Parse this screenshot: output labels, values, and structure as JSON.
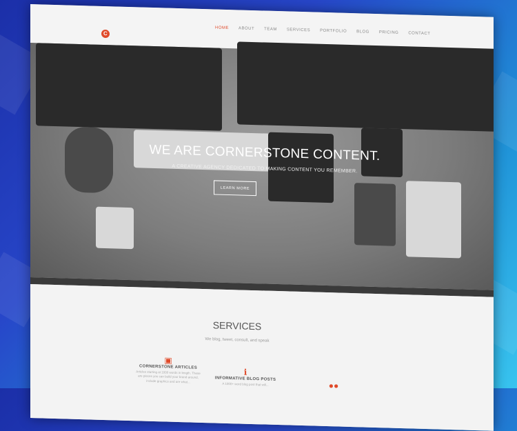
{
  "nav": {
    "items": [
      "HOME",
      "ABOUT",
      "TEAM",
      "SERVICES",
      "PORTFOLIO",
      "BLOG",
      "PRICING",
      "CONTACT"
    ],
    "active": "HOME"
  },
  "logo": {
    "letter": "C"
  },
  "hero": {
    "title": "WE ARE CORNERSTONE CONTENT.",
    "subtitle": "A CREATIVE AGENCY DEDICATED TO MAKING CONTENT YOU REMEMBER.",
    "button": "LEARN MORE"
  },
  "services": {
    "title": "SERVICES",
    "subtitle": "We blog, tweet, consult, and speak",
    "cards": [
      {
        "name": "CORNERSTONE ARTICLES",
        "text": "Articles starting at 1000 words in length. These are pieces you can build your brand around, include graphics and are what..."
      },
      {
        "name": "INFORMATIVE BLOG POSTS",
        "text": "A 1000+ word blog post that will..."
      }
    ]
  },
  "colors": {
    "accent": "#e04a2a",
    "bg_blue": "#2746c9"
  }
}
